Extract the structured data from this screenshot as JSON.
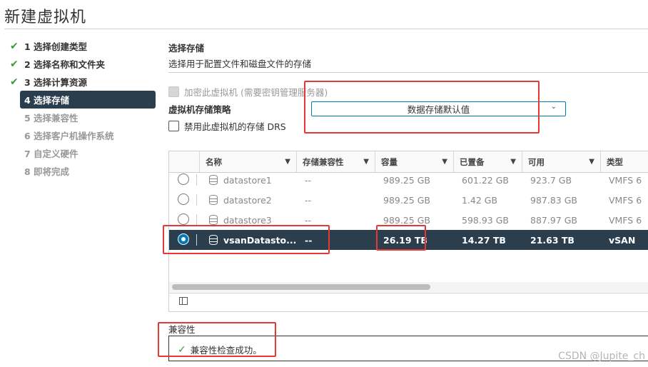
{
  "wizard": {
    "title": "新建虚拟机",
    "steps": [
      {
        "label": "1 选择创建类型",
        "state": "done"
      },
      {
        "label": "2 选择名称和文件夹",
        "state": "done"
      },
      {
        "label": "3 选择计算资源",
        "state": "done"
      },
      {
        "label": "4 选择存储",
        "state": "active"
      },
      {
        "label": "5 选择兼容性",
        "state": "pending"
      },
      {
        "label": "6 选择客户机操作系统",
        "state": "pending"
      },
      {
        "label": "7 自定义硬件",
        "state": "pending"
      },
      {
        "label": "8 即将完成",
        "state": "pending"
      }
    ]
  },
  "storage": {
    "heading": "选择存储",
    "subheading": "选择用于配置文件和磁盘文件的存储",
    "encrypt_label": "加密此虚拟机 (需要密钥管理服务器)",
    "policy_label": "虚拟机存储策略",
    "policy_value": "数据存储默认值",
    "disable_drs_label": "禁用此虚拟机的存储 DRS"
  },
  "grid": {
    "columns": [
      "名称",
      "存储兼容性",
      "容量",
      "已置备",
      "可用",
      "类型"
    ],
    "rows": [
      {
        "name": "datastore1",
        "compat": "--",
        "capacity": "989.25 GB",
        "provisioned": "601.22 GB",
        "free": "923.7 GB",
        "type": "VMFS 6",
        "selected": false
      },
      {
        "name": "datastore2",
        "compat": "--",
        "capacity": "989.25 GB",
        "provisioned": "1.42 GB",
        "free": "987.83 GB",
        "type": "VMFS 6",
        "selected": false
      },
      {
        "name": "datastore3",
        "compat": "--",
        "capacity": "989.25 GB",
        "provisioned": "598.93 GB",
        "free": "887.97 GB",
        "type": "VMFS 6",
        "selected": false
      },
      {
        "name": "vsanDatasto...",
        "compat": "--",
        "capacity": "26.19 TB",
        "provisioned": "14.27 TB",
        "free": "21.63 TB",
        "type": "vSAN",
        "selected": true
      }
    ]
  },
  "compatibility": {
    "label": "兼容性",
    "message": "兼容性检查成功。"
  },
  "watermark": "CSDN @Jupite_ch",
  "colors": {
    "accent": "#0079b8",
    "selected_row": "#2b3e4e",
    "success": "#3c9a3c",
    "highlight": "#e53935"
  }
}
